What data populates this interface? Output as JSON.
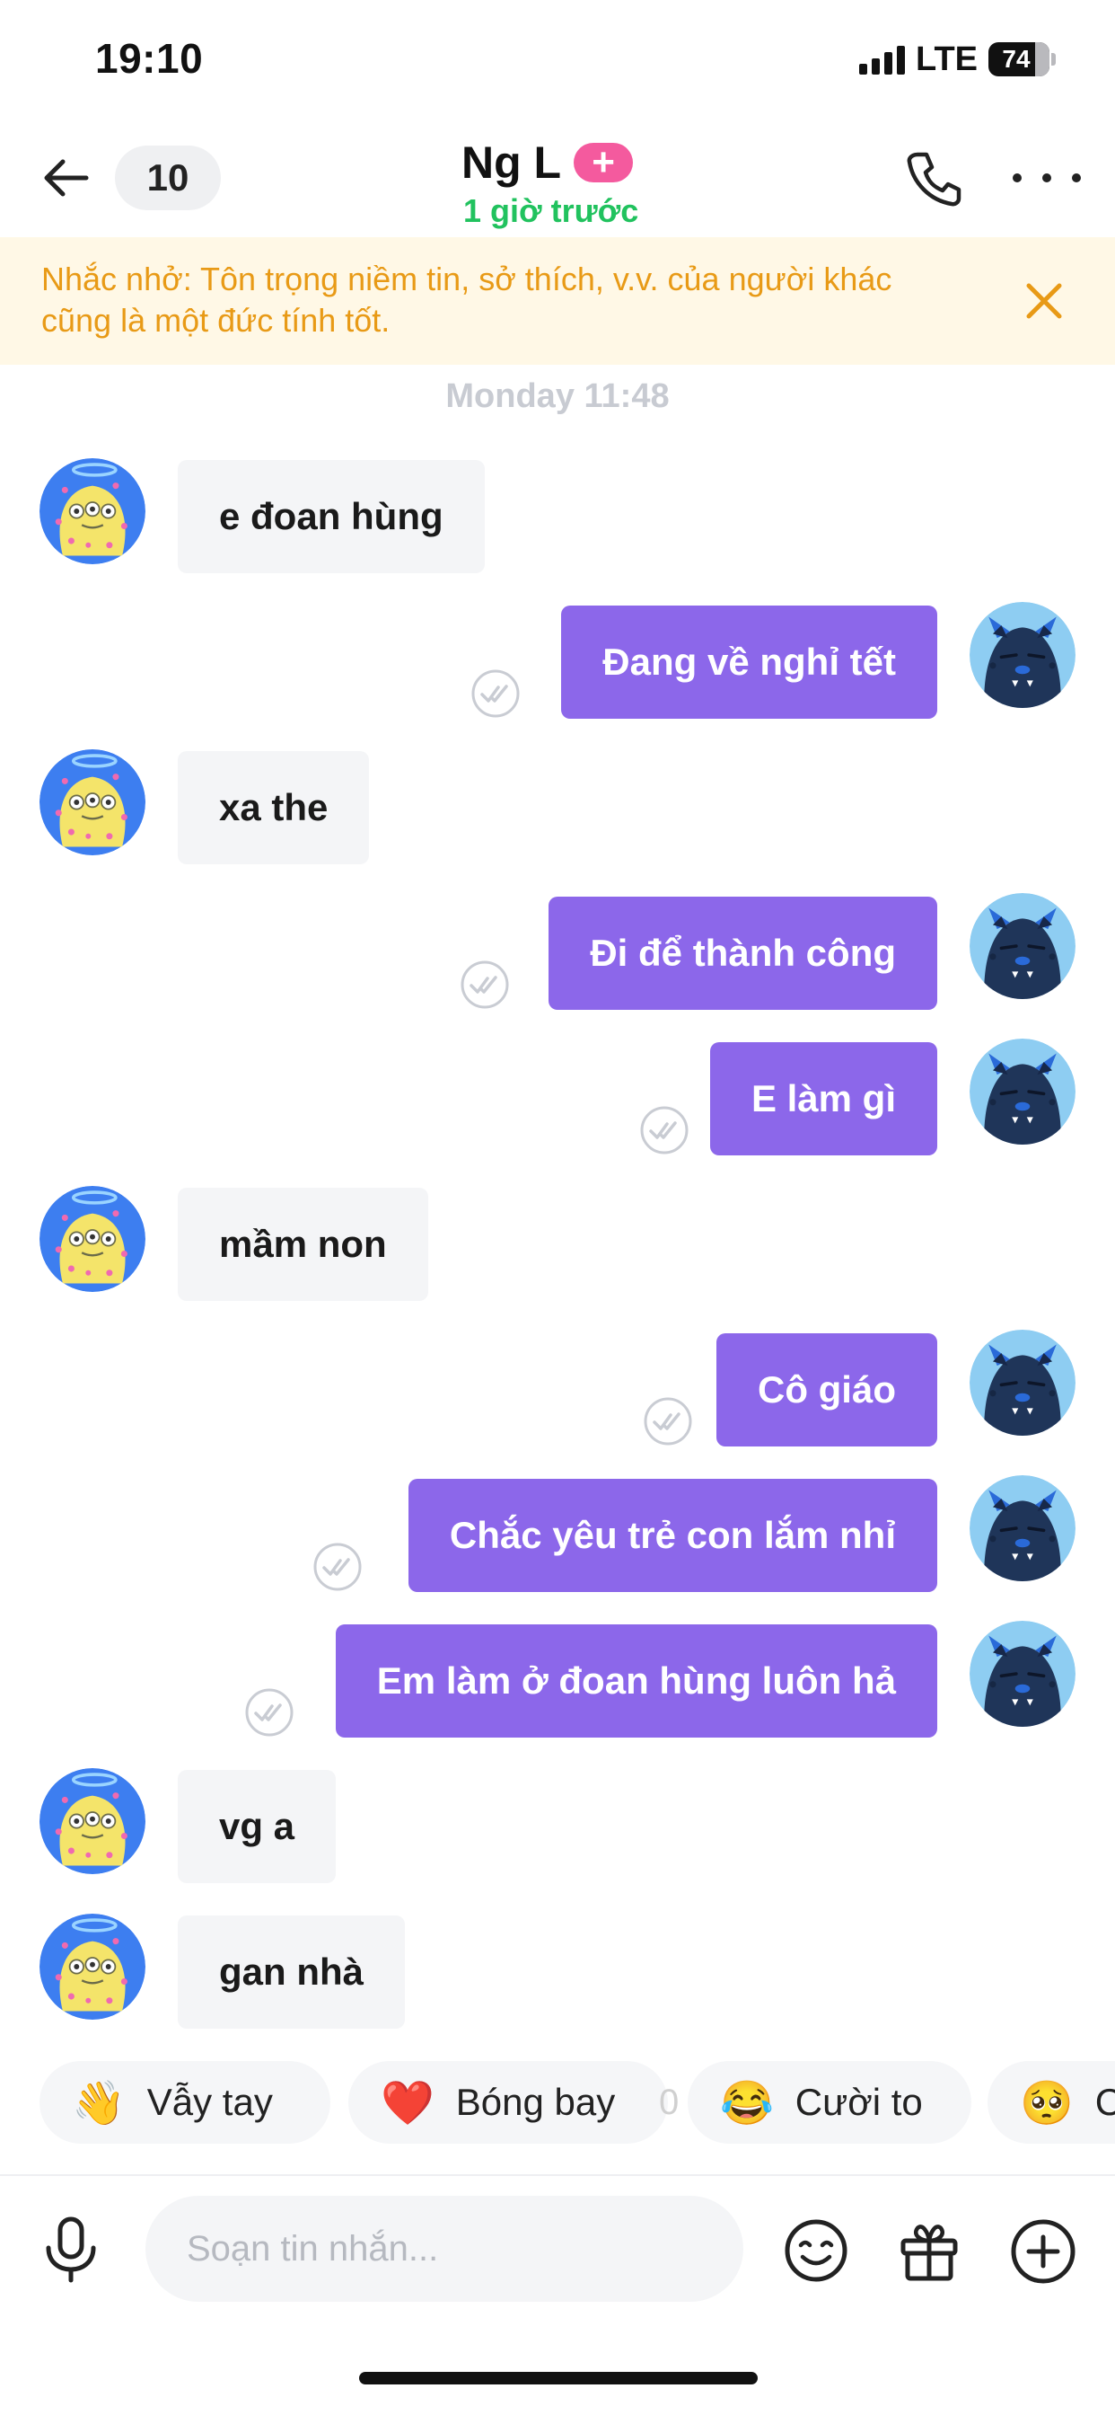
{
  "status_bar": {
    "time": "19:10",
    "network": "LTE",
    "battery": "74"
  },
  "header": {
    "back_count": "10",
    "contact_name": "Ng L",
    "plus_badge": "+",
    "last_seen": "1 giờ trước"
  },
  "reminder": {
    "text": "Nhắc nhở: Tôn trọng niềm tin, sở thích, v.v. của người khác cũng là một đức tính tốt."
  },
  "conversation": {
    "date_separator": "Monday 11:48",
    "messages": [
      {
        "direction": "in",
        "text": "e đoan hùng"
      },
      {
        "direction": "out",
        "text": "Đang về nghỉ tết",
        "status": "read"
      },
      {
        "direction": "in",
        "text": "xa the"
      },
      {
        "direction": "out",
        "text": "Đi để thành công",
        "status": "read"
      },
      {
        "direction": "out",
        "text": "E làm gì",
        "status": "read"
      },
      {
        "direction": "in",
        "text": "mầm non"
      },
      {
        "direction": "out",
        "text": "Cô giáo",
        "status": "read"
      },
      {
        "direction": "out",
        "text": "Chắc yêu trẻ con lắm nhỉ",
        "status": "read"
      },
      {
        "direction": "out",
        "text": "Em làm ở đoan hùng luôn hả",
        "status": "read"
      },
      {
        "direction": "in",
        "text": "vg a"
      },
      {
        "direction": "in",
        "text": "gan nhà"
      }
    ]
  },
  "quick_reactions": [
    {
      "emoji": "👋",
      "label": "Vẫy tay"
    },
    {
      "emoji": "❤️",
      "label": "Bóng bay"
    },
    {
      "emoji": "😂",
      "label": "Cười to"
    },
    {
      "emoji": "🥺",
      "label": "C"
    }
  ],
  "reaction_overflow_glyph": "0",
  "composer": {
    "placeholder": "Soạn tin nhắn..."
  },
  "colors": {
    "outgoing_bubble": "#8c67ea",
    "incoming_bubble": "#f4f5f7",
    "online_status": "#21c25e",
    "reminder_text": "#e89a16",
    "reminder_bg": "#fff8e6",
    "plus_badge": "#f45a9e"
  },
  "icons": {
    "back": "arrow-left-icon",
    "call": "phone-icon",
    "more": "more-horizontal-icon",
    "close": "close-icon",
    "read_receipt": "double-check-icon",
    "mic": "microphone-icon",
    "emoji": "smiley-icon",
    "gift": "gift-icon",
    "add": "plus-circle-icon"
  }
}
